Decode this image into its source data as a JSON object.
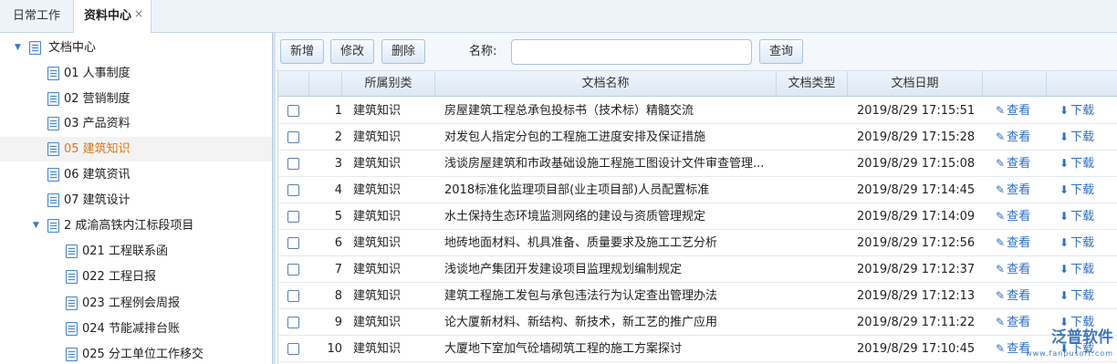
{
  "tabs": [
    {
      "label": "日常工作"
    },
    {
      "label": "资料中心",
      "close": "×"
    }
  ],
  "tree": {
    "root": "文档中心",
    "items": [
      "01 人事制度",
      "02 营销制度",
      "03 产品资料",
      "05 建筑知识",
      "06 建筑资讯",
      "07 建筑设计"
    ],
    "project": "2 成渝高铁内江标段项目",
    "sub": [
      "021 工程联系函",
      "022 工程日报",
      "023 工程例会周报",
      "024 节能减排台账",
      "025 分工单位工作移交"
    ]
  },
  "toolbar": {
    "add": "新增",
    "edit": "修改",
    "del": "删除",
    "name_label": "名称:",
    "name_value": "",
    "search": "查询"
  },
  "table": {
    "headers": {
      "category": "所属别类",
      "name": "文档名称",
      "type": "文档类型",
      "date": "文档日期"
    },
    "view_label": "查看",
    "download_label": "下载",
    "rows": [
      {
        "no": "1",
        "category": "建筑知识",
        "name": "房屋建筑工程总承包投标书（技术标）精髓交流",
        "date": "2019/8/29 17:15:51"
      },
      {
        "no": "2",
        "category": "建筑知识",
        "name": "对发包人指定分包的工程施工进度安排及保证措施",
        "date": "2019/8/29 17:15:28"
      },
      {
        "no": "3",
        "category": "建筑知识",
        "name": "浅谈房屋建筑和市政基础设施工程施工图设计文件审查管理...",
        "date": "2019/8/29 17:15:08"
      },
      {
        "no": "4",
        "category": "建筑知识",
        "name": "2018标准化监理项目部(业主项目部)人员配置标准",
        "date": "2019/8/29 17:14:45"
      },
      {
        "no": "5",
        "category": "建筑知识",
        "name": "水土保持生态环境监测网络的建设与资质管理规定",
        "date": "2019/8/29 17:14:09"
      },
      {
        "no": "6",
        "category": "建筑知识",
        "name": "地砖地面材料、机具准备、质量要求及施工工艺分析",
        "date": "2019/8/29 17:12:56"
      },
      {
        "no": "7",
        "category": "建筑知识",
        "name": "浅谈地产集团开发建设项目监理规划编制规定",
        "date": "2019/8/29 17:12:37"
      },
      {
        "no": "8",
        "category": "建筑知识",
        "name": "建筑工程施工发包与承包违法行为认定查出管理办法",
        "date": "2019/8/29 17:12:13"
      },
      {
        "no": "9",
        "category": "建筑知识",
        "name": "论大厦新材料、新结构、新技术，新工艺的推广应用",
        "date": "2019/8/29 17:11:22"
      },
      {
        "no": "10",
        "category": "建筑知识",
        "name": "大厦地下室加气砼墙砌筑工程的施工方案探讨",
        "date": "2019/8/29 17:10:45"
      }
    ]
  },
  "watermark": {
    "text": "泛普软件",
    "sub": "www.fanpusoft.com"
  },
  "colors": {
    "accent": "#2e6fc4",
    "selected": "#e0731a"
  }
}
